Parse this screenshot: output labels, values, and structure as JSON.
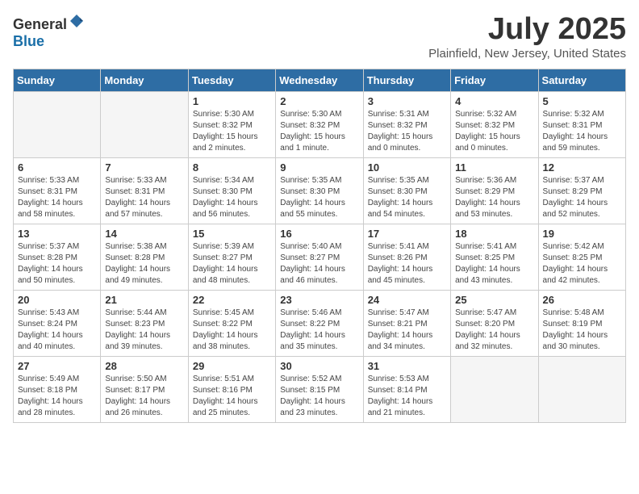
{
  "header": {
    "logo_general": "General",
    "logo_blue": "Blue",
    "month": "July 2025",
    "location": "Plainfield, New Jersey, United States"
  },
  "days_of_week": [
    "Sunday",
    "Monday",
    "Tuesday",
    "Wednesday",
    "Thursday",
    "Friday",
    "Saturday"
  ],
  "weeks": [
    [
      {
        "day": "",
        "empty": true
      },
      {
        "day": "",
        "empty": true
      },
      {
        "day": "1",
        "sunrise": "Sunrise: 5:30 AM",
        "sunset": "Sunset: 8:32 PM",
        "daylight": "Daylight: 15 hours and 2 minutes."
      },
      {
        "day": "2",
        "sunrise": "Sunrise: 5:30 AM",
        "sunset": "Sunset: 8:32 PM",
        "daylight": "Daylight: 15 hours and 1 minute."
      },
      {
        "day": "3",
        "sunrise": "Sunrise: 5:31 AM",
        "sunset": "Sunset: 8:32 PM",
        "daylight": "Daylight: 15 hours and 0 minutes."
      },
      {
        "day": "4",
        "sunrise": "Sunrise: 5:32 AM",
        "sunset": "Sunset: 8:32 PM",
        "daylight": "Daylight: 15 hours and 0 minutes."
      },
      {
        "day": "5",
        "sunrise": "Sunrise: 5:32 AM",
        "sunset": "Sunset: 8:31 PM",
        "daylight": "Daylight: 14 hours and 59 minutes."
      }
    ],
    [
      {
        "day": "6",
        "sunrise": "Sunrise: 5:33 AM",
        "sunset": "Sunset: 8:31 PM",
        "daylight": "Daylight: 14 hours and 58 minutes."
      },
      {
        "day": "7",
        "sunrise": "Sunrise: 5:33 AM",
        "sunset": "Sunset: 8:31 PM",
        "daylight": "Daylight: 14 hours and 57 minutes."
      },
      {
        "day": "8",
        "sunrise": "Sunrise: 5:34 AM",
        "sunset": "Sunset: 8:30 PM",
        "daylight": "Daylight: 14 hours and 56 minutes."
      },
      {
        "day": "9",
        "sunrise": "Sunrise: 5:35 AM",
        "sunset": "Sunset: 8:30 PM",
        "daylight": "Daylight: 14 hours and 55 minutes."
      },
      {
        "day": "10",
        "sunrise": "Sunrise: 5:35 AM",
        "sunset": "Sunset: 8:30 PM",
        "daylight": "Daylight: 14 hours and 54 minutes."
      },
      {
        "day": "11",
        "sunrise": "Sunrise: 5:36 AM",
        "sunset": "Sunset: 8:29 PM",
        "daylight": "Daylight: 14 hours and 53 minutes."
      },
      {
        "day": "12",
        "sunrise": "Sunrise: 5:37 AM",
        "sunset": "Sunset: 8:29 PM",
        "daylight": "Daylight: 14 hours and 52 minutes."
      }
    ],
    [
      {
        "day": "13",
        "sunrise": "Sunrise: 5:37 AM",
        "sunset": "Sunset: 8:28 PM",
        "daylight": "Daylight: 14 hours and 50 minutes."
      },
      {
        "day": "14",
        "sunrise": "Sunrise: 5:38 AM",
        "sunset": "Sunset: 8:28 PM",
        "daylight": "Daylight: 14 hours and 49 minutes."
      },
      {
        "day": "15",
        "sunrise": "Sunrise: 5:39 AM",
        "sunset": "Sunset: 8:27 PM",
        "daylight": "Daylight: 14 hours and 48 minutes."
      },
      {
        "day": "16",
        "sunrise": "Sunrise: 5:40 AM",
        "sunset": "Sunset: 8:27 PM",
        "daylight": "Daylight: 14 hours and 46 minutes."
      },
      {
        "day": "17",
        "sunrise": "Sunrise: 5:41 AM",
        "sunset": "Sunset: 8:26 PM",
        "daylight": "Daylight: 14 hours and 45 minutes."
      },
      {
        "day": "18",
        "sunrise": "Sunrise: 5:41 AM",
        "sunset": "Sunset: 8:25 PM",
        "daylight": "Daylight: 14 hours and 43 minutes."
      },
      {
        "day": "19",
        "sunrise": "Sunrise: 5:42 AM",
        "sunset": "Sunset: 8:25 PM",
        "daylight": "Daylight: 14 hours and 42 minutes."
      }
    ],
    [
      {
        "day": "20",
        "sunrise": "Sunrise: 5:43 AM",
        "sunset": "Sunset: 8:24 PM",
        "daylight": "Daylight: 14 hours and 40 minutes."
      },
      {
        "day": "21",
        "sunrise": "Sunrise: 5:44 AM",
        "sunset": "Sunset: 8:23 PM",
        "daylight": "Daylight: 14 hours and 39 minutes."
      },
      {
        "day": "22",
        "sunrise": "Sunrise: 5:45 AM",
        "sunset": "Sunset: 8:22 PM",
        "daylight": "Daylight: 14 hours and 38 minutes."
      },
      {
        "day": "23",
        "sunrise": "Sunrise: 5:46 AM",
        "sunset": "Sunset: 8:22 PM",
        "daylight": "Daylight: 14 hours and 35 minutes."
      },
      {
        "day": "24",
        "sunrise": "Sunrise: 5:47 AM",
        "sunset": "Sunset: 8:21 PM",
        "daylight": "Daylight: 14 hours and 34 minutes."
      },
      {
        "day": "25",
        "sunrise": "Sunrise: 5:47 AM",
        "sunset": "Sunset: 8:20 PM",
        "daylight": "Daylight: 14 hours and 32 minutes."
      },
      {
        "day": "26",
        "sunrise": "Sunrise: 5:48 AM",
        "sunset": "Sunset: 8:19 PM",
        "daylight": "Daylight: 14 hours and 30 minutes."
      }
    ],
    [
      {
        "day": "27",
        "sunrise": "Sunrise: 5:49 AM",
        "sunset": "Sunset: 8:18 PM",
        "daylight": "Daylight: 14 hours and 28 minutes."
      },
      {
        "day": "28",
        "sunrise": "Sunrise: 5:50 AM",
        "sunset": "Sunset: 8:17 PM",
        "daylight": "Daylight: 14 hours and 26 minutes."
      },
      {
        "day": "29",
        "sunrise": "Sunrise: 5:51 AM",
        "sunset": "Sunset: 8:16 PM",
        "daylight": "Daylight: 14 hours and 25 minutes."
      },
      {
        "day": "30",
        "sunrise": "Sunrise: 5:52 AM",
        "sunset": "Sunset: 8:15 PM",
        "daylight": "Daylight: 14 hours and 23 minutes."
      },
      {
        "day": "31",
        "sunrise": "Sunrise: 5:53 AM",
        "sunset": "Sunset: 8:14 PM",
        "daylight": "Daylight: 14 hours and 21 minutes."
      },
      {
        "day": "",
        "empty": true
      },
      {
        "day": "",
        "empty": true
      }
    ]
  ]
}
